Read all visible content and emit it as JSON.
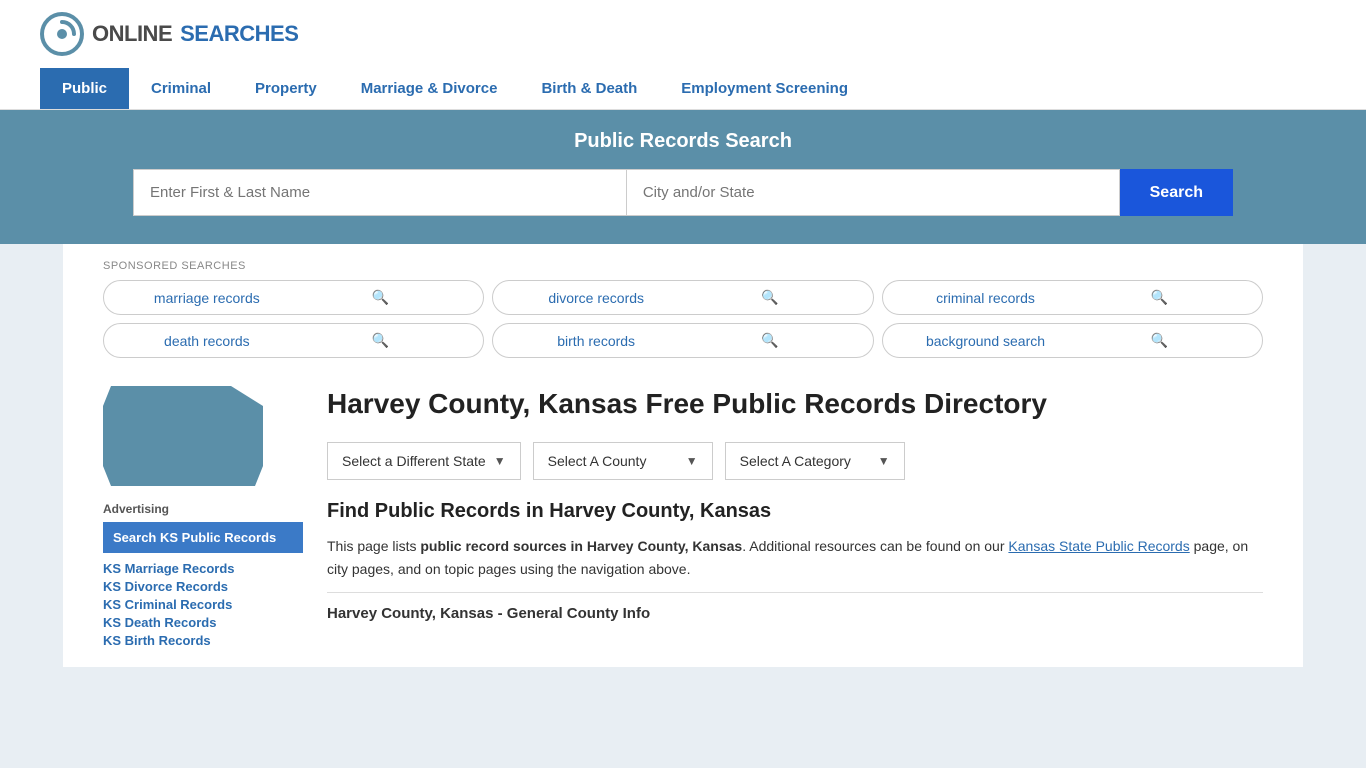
{
  "site": {
    "logo_online": "ONLINE",
    "logo_searches": "SEARCHES"
  },
  "nav": {
    "items": [
      {
        "label": "Public",
        "active": true
      },
      {
        "label": "Criminal",
        "active": false
      },
      {
        "label": "Property",
        "active": false
      },
      {
        "label": "Marriage & Divorce",
        "active": false
      },
      {
        "label": "Birth & Death",
        "active": false
      },
      {
        "label": "Employment Screening",
        "active": false
      }
    ]
  },
  "search_section": {
    "title": "Public Records Search",
    "name_placeholder": "Enter First & Last Name",
    "location_placeholder": "City and/or State",
    "search_button": "Search"
  },
  "sponsored": {
    "label": "SPONSORED SEARCHES",
    "items": [
      "marriage records",
      "divorce records",
      "criminal records",
      "death records",
      "birth records",
      "background search"
    ]
  },
  "page": {
    "title": "Harvey County, Kansas Free Public Records Directory",
    "find_title": "Find Public Records in Harvey County, Kansas",
    "description_part1": "This page lists ",
    "description_bold": "public record sources in Harvey County, Kansas",
    "description_part2": ". Additional resources can be found on our ",
    "description_link": "Kansas State Public Records",
    "description_part3": " page, on city pages, and on topic pages using the navigation above.",
    "county_info_label": "Harvey County, Kansas - General County Info"
  },
  "dropdowns": {
    "state": "Select a Different State",
    "county": "Select A County",
    "category": "Select A Category"
  },
  "sidebar": {
    "advertising_label": "Advertising",
    "ad_box_text": "Search KS Public Records",
    "links": [
      "KS Marriage Records",
      "KS Divorce Records",
      "KS Criminal Records",
      "KS Death Records",
      "KS Birth Records"
    ]
  }
}
